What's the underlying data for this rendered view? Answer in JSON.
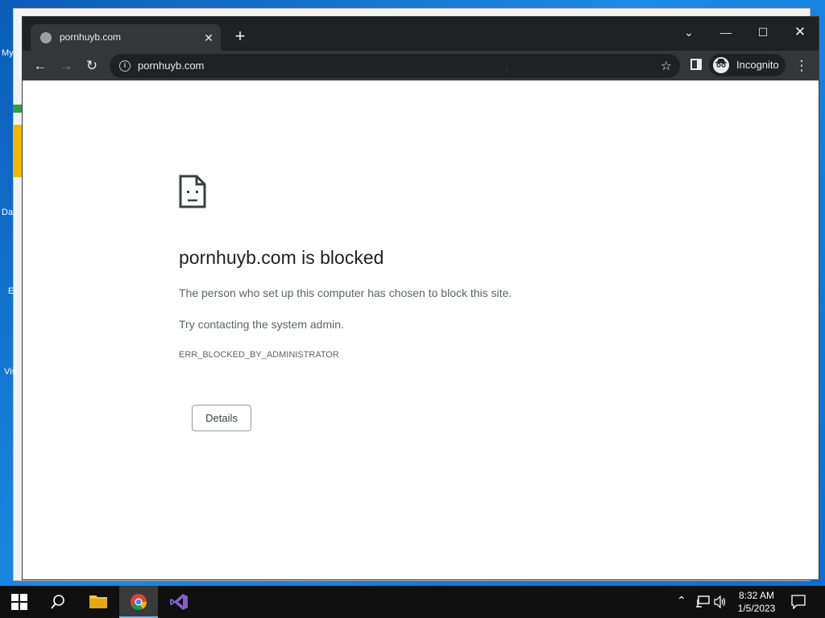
{
  "desktop": {
    "icon_labels": [
      "My",
      "Da",
      "E",
      "Vis"
    ]
  },
  "browser": {
    "tab": {
      "title": "pornhuyb.com",
      "favicon": "globe-icon"
    },
    "omnibox": {
      "url": "pornhuyb.com"
    },
    "profile_label": "Incognito",
    "theme": {
      "frame": "#202124",
      "toolbar": "#35363a"
    }
  },
  "error_page": {
    "title": "pornhuyb.com is blocked",
    "description": "The person who set up this computer has chosen to block this site.",
    "suggestion": "Try contacting the system admin.",
    "error_code": "ERR_BLOCKED_BY_ADMINISTRATOR",
    "details_button": "Details"
  },
  "taskbar": {
    "apps": [
      "file-explorer",
      "google-chrome",
      "visual-studio"
    ],
    "active_app": "google-chrome",
    "time": "8:32 AM",
    "date": "1/5/2023"
  }
}
